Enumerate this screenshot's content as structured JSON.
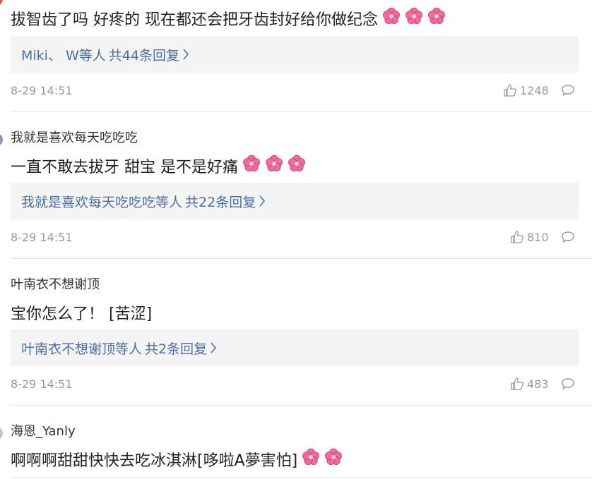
{
  "comments": [
    {
      "username": "",
      "text": "拔智齿了吗 好疼的 现在都还会把牙齿封好给你做纪念",
      "emoji_count": 3,
      "reply_names": "Miki、 W",
      "reply_etc": "等人",
      "reply_count": "共44条回复",
      "time": "8-29 14:51",
      "likes": "1248"
    },
    {
      "username": "我就是喜欢每天吃吃吃",
      "text": "一直不敢去拔牙 甜宝 是不是好痛",
      "emoji_count": 3,
      "reply_names": "我就是喜欢每天吃吃吃",
      "reply_etc": "等人",
      "reply_count": "共22条回复",
      "time": "8-29 14:51",
      "likes": "810"
    },
    {
      "username": "叶南衣不想谢顶",
      "text": "宝你怎么了！ [苦涩]",
      "emoji_count": 0,
      "reply_names": "叶南衣不想谢顶",
      "reply_etc": "等人",
      "reply_count": "共2条回复",
      "time": "8-29 14:51",
      "likes": "483"
    },
    {
      "username": "海恩_Yanly",
      "text": "啊啊啊甜甜快快去吃冰淇淋[哆啦A夢害怕]",
      "emoji_count": 2
    }
  ],
  "icons": {
    "emoji": "cherry-blossom-icon",
    "like": "thumbs-up-icon",
    "reply": "comment-bubble-icon",
    "more": "chevron-right-icon"
  },
  "colors": {
    "link": "#4c6fa0",
    "meta": "#999999",
    "reply_bg": "#f4f4f4",
    "blossom": "#f06a9b"
  }
}
